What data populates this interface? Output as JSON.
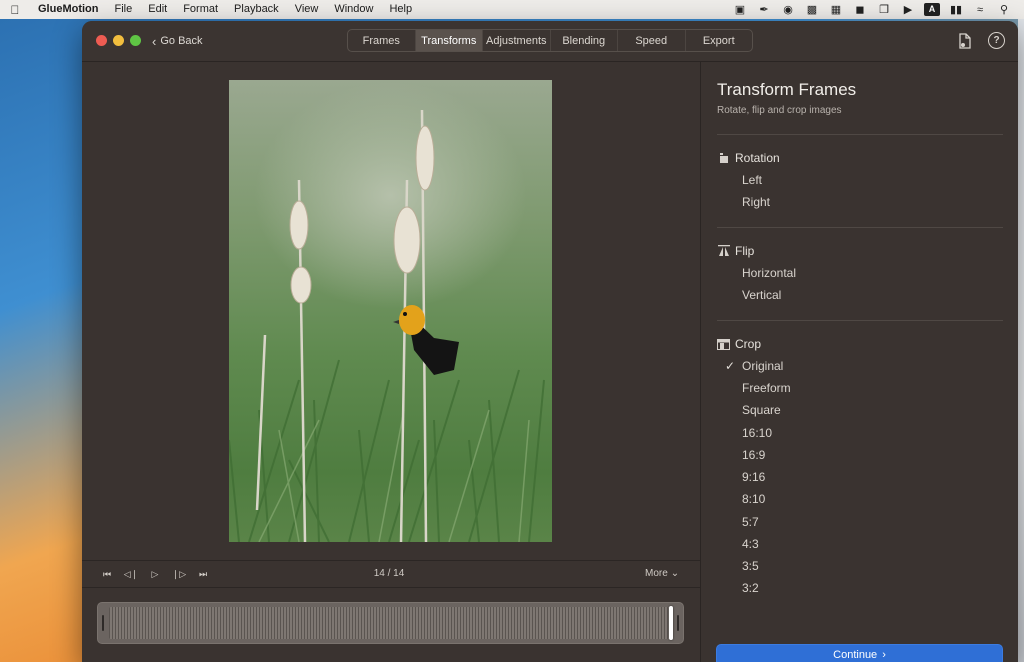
{
  "menubar": {
    "app_name": "GlueMotion",
    "items": [
      "File",
      "Edit",
      "Format",
      "Playback",
      "View",
      "Window",
      "Help"
    ],
    "input_badge": "A"
  },
  "window": {
    "back_label": "Go Back",
    "tabs": [
      {
        "label": "Frames",
        "active": false
      },
      {
        "label": "Transforms",
        "active": true
      },
      {
        "label": "Adjustments",
        "active": false
      },
      {
        "label": "Blending",
        "active": false
      },
      {
        "label": "Speed",
        "active": false
      },
      {
        "label": "Export",
        "active": false
      }
    ],
    "help_glyph": "?"
  },
  "preview": {
    "frame_counter": "14 / 14",
    "more_label": "More",
    "playhead_fraction": 1.0
  },
  "sidebar": {
    "title": "Transform Frames",
    "subtitle": "Rotate, flip and crop images",
    "rotation": {
      "heading": "Rotation",
      "options": [
        "Left",
        "Right"
      ]
    },
    "flip": {
      "heading": "Flip",
      "options": [
        "Horizontal",
        "Vertical"
      ]
    },
    "crop": {
      "heading": "Crop",
      "selected": "Original",
      "options": [
        "Original",
        "Freeform",
        "Square",
        "16:10",
        "16:9",
        "9:16",
        "8:10",
        "5:7",
        "4:3",
        "3:5",
        "3:2"
      ]
    },
    "continue_label": "Continue"
  },
  "colors": {
    "window_bg": "#3a3330",
    "accent_button": "#2f6fd6",
    "active_tab": "#5a524d"
  }
}
